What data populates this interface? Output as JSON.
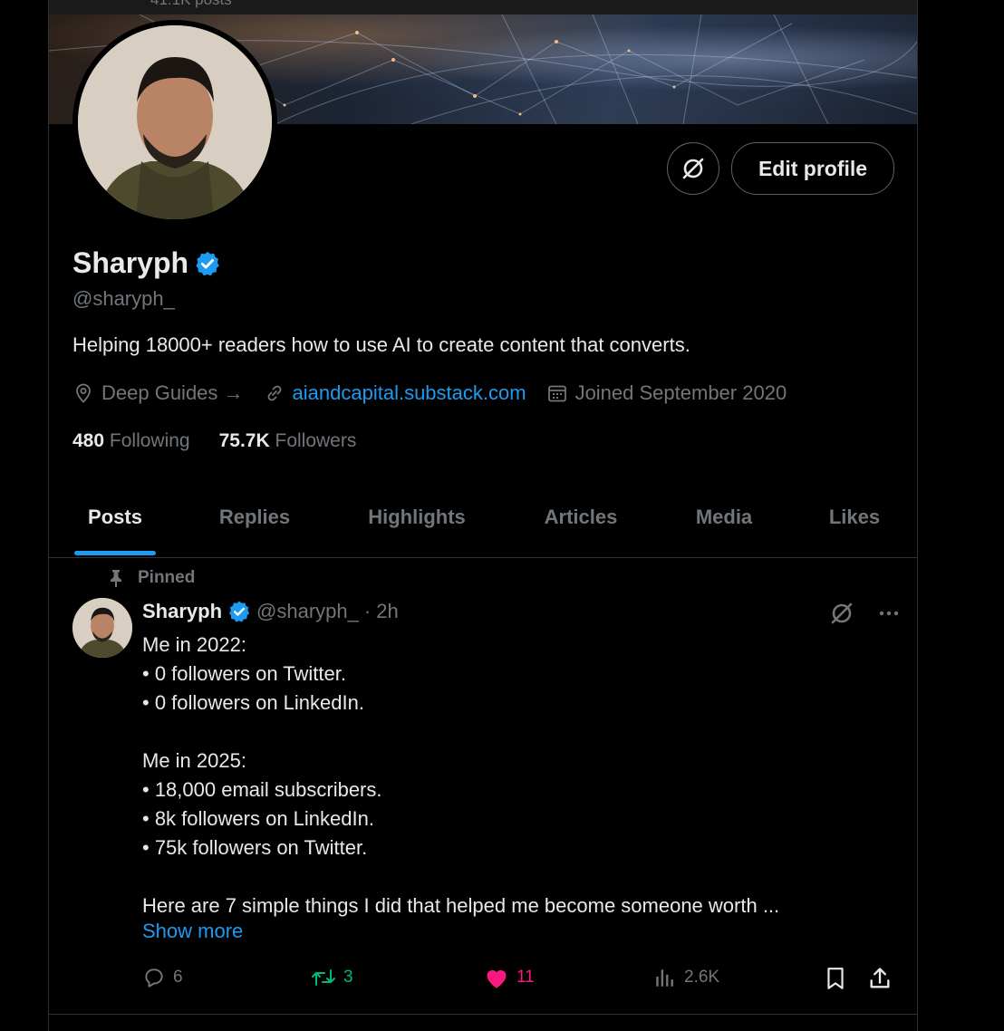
{
  "header": {
    "post_count": "41.1K posts"
  },
  "profile": {
    "name": "Sharyph",
    "handle": "@sharyph_",
    "bio": "Helping 18000+ readers how to use AI to create content that converts.",
    "category": "Deep Guides →",
    "website": "aiandcapital.substack.com",
    "joined": "Joined September 2020",
    "following_count": "480",
    "following_label": "Following",
    "followers_count": "75.7K",
    "followers_label": "Followers",
    "edit_label": "Edit profile"
  },
  "tabs": [
    {
      "label": "Posts",
      "active": true
    },
    {
      "label": "Replies"
    },
    {
      "label": "Highlights"
    },
    {
      "label": "Articles"
    },
    {
      "label": "Media"
    },
    {
      "label": "Likes"
    }
  ],
  "post": {
    "pinned_label": "Pinned",
    "author_name": "Sharyph",
    "author_handle": "@sharyph_",
    "dot": "·",
    "time": "2h",
    "lines": [
      "Me in 2022:",
      "• 0 followers on Twitter.",
      "• 0 followers on LinkedIn.",
      "",
      "Me in 2025:",
      "• 18,000 email subscribers.",
      "• 8k followers on LinkedIn.",
      "• 75k followers on Twitter.",
      "",
      "Here are 7 simple things I did that helped me become someone worth ..."
    ],
    "show_more": "Show more",
    "replies": "6",
    "reposts": "3",
    "likes": "11",
    "views": "2.6K"
  },
  "colors": {
    "accent": "#1d9bf0",
    "retweet": "#00ba7c",
    "like": "#f91880",
    "muted": "#71767b"
  }
}
